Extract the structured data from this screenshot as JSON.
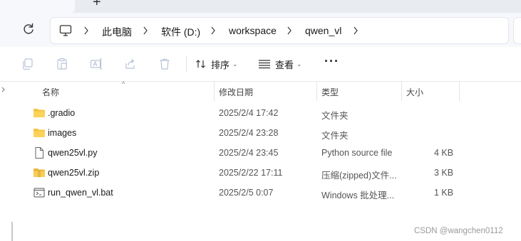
{
  "window": {
    "new_tab_icon": "plus-icon",
    "close_icon": "close-icon"
  },
  "address_bar": {
    "pc_icon": "computer-icon",
    "crumbs": [
      "此电脑",
      "软件 (D:)",
      "workspace",
      "qwen_vl"
    ]
  },
  "toolbar": {
    "icons": [
      "copy-icon",
      "paste-icon",
      "rename-icon",
      "share-icon",
      "delete-icon"
    ],
    "sort_label": "排序",
    "view_label": "查看",
    "more_label": "···"
  },
  "columns": {
    "name": "名称",
    "modified": "修改日期",
    "type": "类型",
    "size": "大小"
  },
  "files": [
    {
      "name": ".gradio",
      "modified": "2025/2/4 17:42",
      "type": "文件夹",
      "size": "",
      "icon": "folder-icon"
    },
    {
      "name": "images",
      "modified": "2025/2/4 23:28",
      "type": "文件夹",
      "size": "",
      "icon": "folder-icon"
    },
    {
      "name": "qwen25vl.py",
      "modified": "2025/2/4 23:45",
      "type": "Python source file",
      "size": "4 KB",
      "icon": "file-icon"
    },
    {
      "name": "qwen25vl.zip",
      "modified": "2025/2/22 17:11",
      "type": "压缩(zipped)文件...",
      "size": "3 KB",
      "icon": "zip-folder-icon"
    },
    {
      "name": "run_qwen_vl.bat",
      "modified": "2025/2/5 0:07",
      "type": "Windows 批处理...",
      "size": "1 KB",
      "icon": "batch-file-icon"
    }
  ],
  "watermark": "CSDN @wangchen0112"
}
